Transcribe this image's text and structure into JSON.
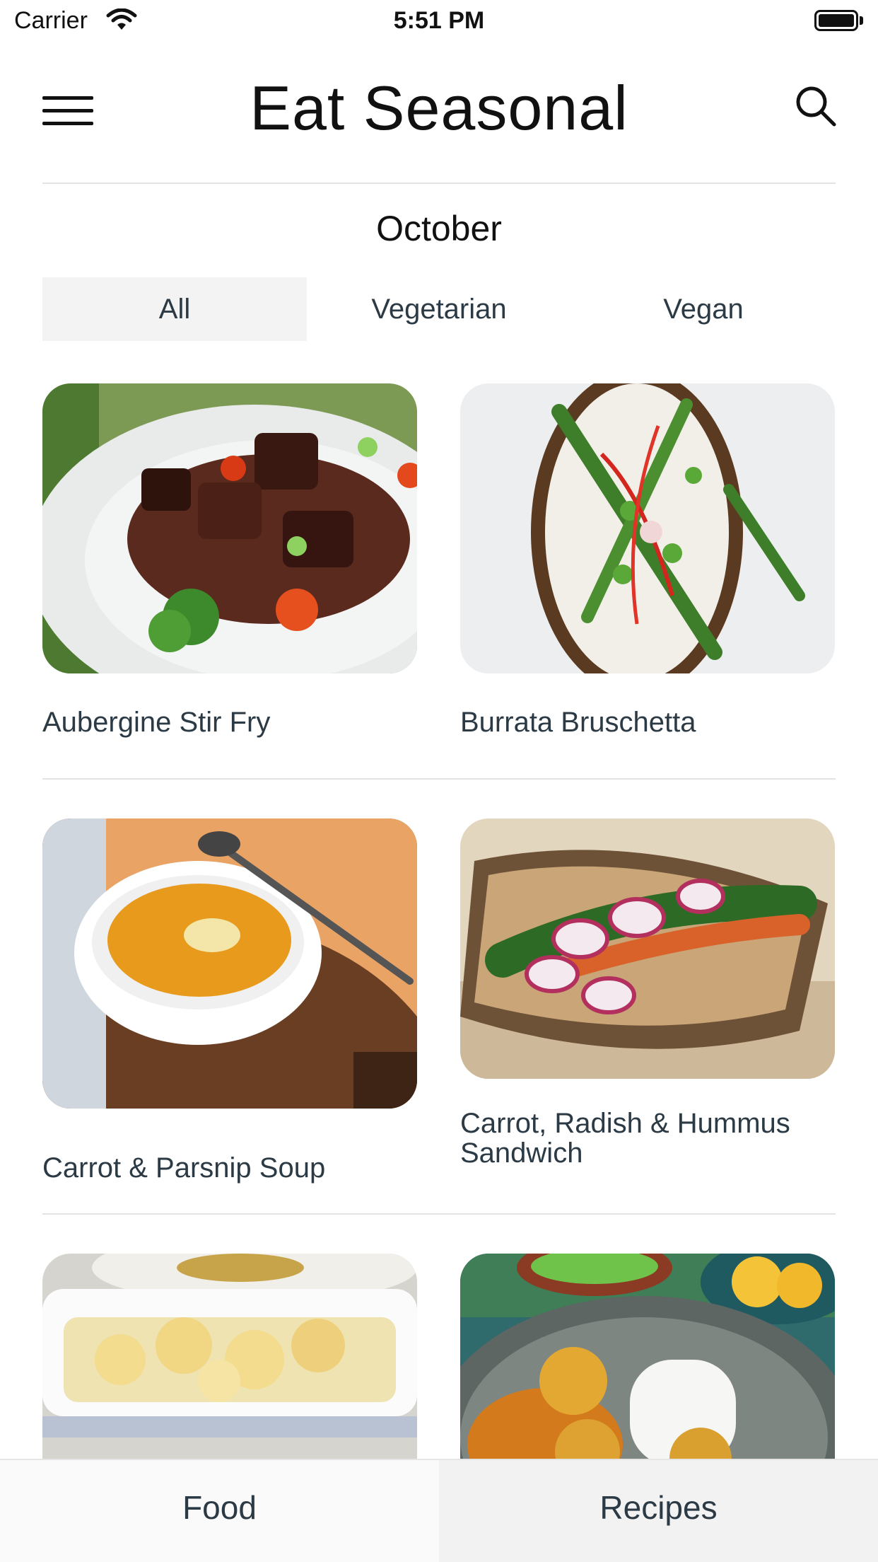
{
  "status_bar": {
    "carrier": "Carrier",
    "time": "5:51 PM"
  },
  "header": {
    "title": "Eat Seasonal",
    "menu_icon": "hamburger-menu-icon",
    "search_icon": "search-icon"
  },
  "month": "October",
  "filters": [
    {
      "label": "All",
      "active": true
    },
    {
      "label": "Vegetarian",
      "active": false
    },
    {
      "label": "Vegan",
      "active": false
    }
  ],
  "recipes": [
    {
      "title": "Aubergine Stir Fry"
    },
    {
      "title": "Burrata Bruschetta"
    },
    {
      "title": "Carrot & Parsnip Soup"
    },
    {
      "title": "Carrot, Radish & Hummus Sandwich"
    },
    {
      "title": ""
    },
    {
      "title": ""
    }
  ],
  "tab_bar": {
    "tabs": [
      {
        "label": "Food",
        "active": false
      },
      {
        "label": "Recipes",
        "active": true
      }
    ]
  },
  "colors": {
    "text": "#2b3a44",
    "divider": "#e3e3e3",
    "active_tab_bg": "#f3f3f3"
  }
}
